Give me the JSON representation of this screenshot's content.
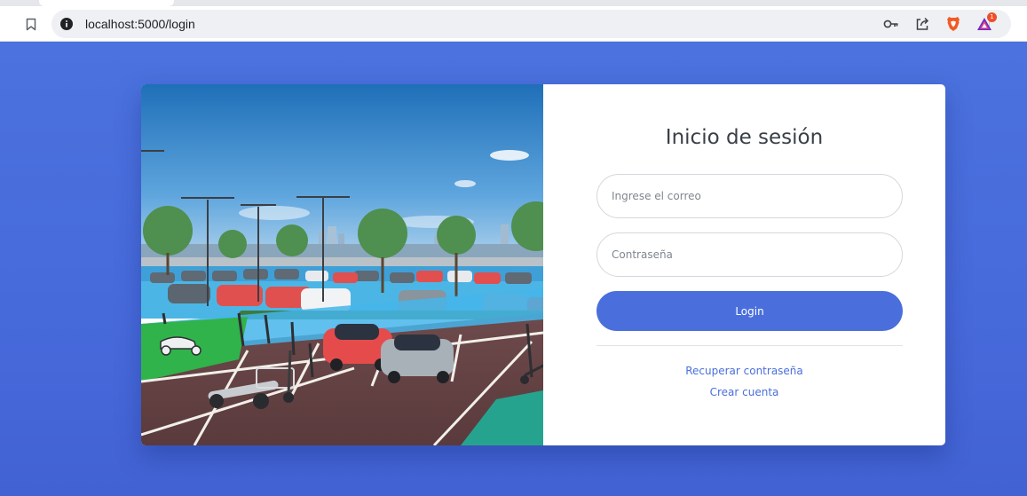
{
  "browser": {
    "url": "localhost:5000/login",
    "icons": {
      "bookmark": "bookmark-icon",
      "site_info": "info-icon",
      "password": "key-icon",
      "share": "share-icon",
      "brave": "brave-shield-icon",
      "rewards": "brave-rewards-icon"
    },
    "rewards_badge": "1"
  },
  "login": {
    "title": "Inicio de sesión",
    "email_placeholder": "Ingrese el correo",
    "password_placeholder": "Contraseña",
    "submit_label": "Login",
    "recover_link": "Recuperar contraseña",
    "create_link": "Crear cuenta"
  },
  "colors": {
    "page_background": "#4a6fdc",
    "primary_button": "#4a6fdc",
    "link": "#4a6fdc"
  }
}
